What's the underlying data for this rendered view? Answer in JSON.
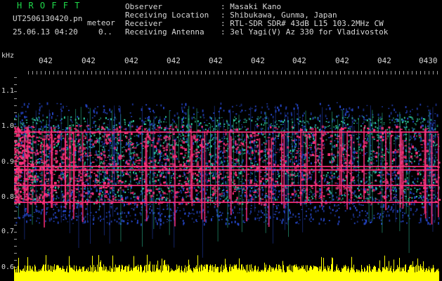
{
  "header": {
    "brand": "H R O F F T",
    "file_name": "UT2506130420.pn",
    "mode": "meteor",
    "datetime": "25.06.13 04:20",
    "page_indicator": "0.."
  },
  "station": {
    "observer_label": "Observer",
    "observer_value": ": Masaki Kano",
    "location_label": "Receiving Location",
    "location_value": ": Shibukawa, Gunma, Japan",
    "receiver_label": "Receiver",
    "receiver_value": ": RTL-SDR SDR# 43dB L15 103.2MHz CW",
    "antenna_label": "Receiving Antenna",
    "antenna_value": ": 3el Yagi(V) Az 330 for Vladivostok"
  },
  "axes": {
    "y_unit": "kHz",
    "y_ticks": [
      "1.1",
      "1.0",
      "0.9",
      "0.8",
      "0.7",
      "0.6"
    ],
    "x_ticks": [
      "042",
      "042",
      "042",
      "042",
      "042",
      "042",
      "042",
      "042",
      "042",
      "0430"
    ]
  },
  "colors": {
    "background": "#000000",
    "brand": "#1fd94a",
    "text": "#d8d8d8",
    "signal_high": "#ff2f7a",
    "signal_mid": "#2fd0a0",
    "signal_low": "#2546c8",
    "power_bar": "#ffff00"
  }
}
